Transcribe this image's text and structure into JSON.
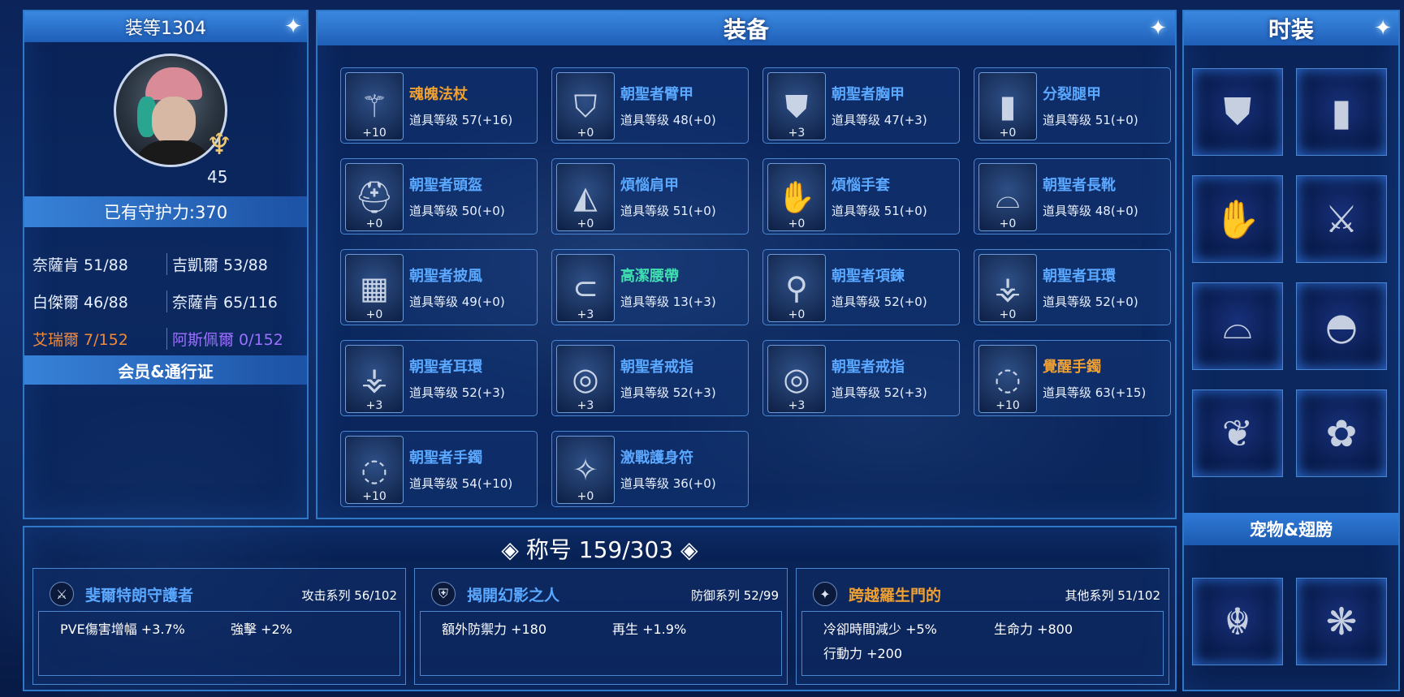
{
  "left": {
    "gear_score": "装等1304",
    "level": "45",
    "guard_power": "已有守护力:370",
    "stats": [
      [
        "奈薩肯 51/88",
        "吉凱爾 53/88"
      ],
      [
        "白傑爾 46/88",
        "奈薩肯 65/116"
      ],
      [
        "艾瑞爾 7/152",
        "阿斯佩爾 0/152"
      ]
    ],
    "membership": "会员&通行证"
  },
  "equipment": {
    "title": "装备",
    "items": [
      {
        "name": "魂魄法杖",
        "level": "道具等级 57(+16)",
        "plus": "+10",
        "color": "orange",
        "icon": "staff-icon"
      },
      {
        "name": "朝聖者臂甲",
        "level": "道具等级 48(+0)",
        "plus": "+0",
        "color": "blue",
        "icon": "shoulder-armor-icon"
      },
      {
        "name": "朝聖者胸甲",
        "level": "道具等级 47(+3)",
        "plus": "+3",
        "color": "blue",
        "icon": "chest-armor-icon"
      },
      {
        "name": "分裂腿甲",
        "level": "道具等级 51(+0)",
        "plus": "+0",
        "color": "blue",
        "icon": "leg-armor-icon"
      },
      {
        "name": "朝聖者頭盔",
        "level": "道具等级 50(+0)",
        "plus": "+0",
        "color": "blue",
        "icon": "helmet-icon"
      },
      {
        "name": "煩惱肩甲",
        "level": "道具等级 51(+0)",
        "plus": "+0",
        "color": "blue",
        "icon": "pauldron-icon"
      },
      {
        "name": "煩惱手套",
        "level": "道具等级 51(+0)",
        "plus": "+0",
        "color": "blue",
        "icon": "glove-icon"
      },
      {
        "name": "朝聖者長靴",
        "level": "道具等级 48(+0)",
        "plus": "+0",
        "color": "blue",
        "icon": "boots-icon"
      },
      {
        "name": "朝聖者披風",
        "level": "道具等级 49(+0)",
        "plus": "+0",
        "color": "blue",
        "icon": "cape-icon"
      },
      {
        "name": "高潔腰帶",
        "level": "道具等级 13(+3)",
        "plus": "+3",
        "color": "green",
        "icon": "belt-icon"
      },
      {
        "name": "朝聖者項鍊",
        "level": "道具等级 52(+0)",
        "plus": "+0",
        "color": "blue",
        "icon": "necklace-icon"
      },
      {
        "name": "朝聖者耳環",
        "level": "道具等级 52(+0)",
        "plus": "+0",
        "color": "blue",
        "icon": "earring-icon"
      },
      {
        "name": "朝聖者耳環",
        "level": "道具等级 52(+3)",
        "plus": "+3",
        "color": "blue",
        "icon": "earring-icon"
      },
      {
        "name": "朝聖者戒指",
        "level": "道具等级 52(+3)",
        "plus": "+3",
        "color": "blue",
        "icon": "ring-icon"
      },
      {
        "name": "朝聖者戒指",
        "level": "道具等级 52(+3)",
        "plus": "+3",
        "color": "blue",
        "icon": "ring-icon"
      },
      {
        "name": "覺醒手鐲",
        "level": "道具等级 63(+15)",
        "plus": "+10",
        "color": "orange",
        "icon": "bracelet-icon"
      },
      {
        "name": "朝聖者手鐲",
        "level": "道具等级 54(+10)",
        "plus": "+10",
        "color": "blue",
        "icon": "bracelet-icon"
      },
      {
        "name": "激戰護身符",
        "level": "道具等级 36(+0)",
        "plus": "+0",
        "color": "blue",
        "icon": "amulet-icon"
      }
    ]
  },
  "costume": {
    "title": "时装",
    "items": [
      "vest-icon",
      "pants-icon",
      "glove-icon",
      "weapon-icon",
      "boots-icon",
      "cap-icon",
      "wing-icon",
      "octopus-pet-icon"
    ],
    "pet_wing_title": "宠物&翅膀",
    "pet_wing_items": [
      "dragon-icon",
      "beast-icon"
    ]
  },
  "titles": {
    "header": "称号 159/303",
    "cards": [
      {
        "name": "斐爾特朗守護者",
        "series": "攻击系列 56/102",
        "color": "blue",
        "effects": [
          "PVE傷害增幅 +3.7%",
          "強擊 +2%"
        ]
      },
      {
        "name": "揭開幻影之人",
        "series": "防御系列 52/99",
        "color": "blue",
        "effects": [
          "額外防禦力 +180",
          "再生 +1.9%"
        ]
      },
      {
        "name": "跨越羅生門的",
        "series": "其他系列 51/102",
        "color": "orange",
        "effects": [
          "冷卻時間減少 +5%",
          "生命力 +800",
          "行動力 +200"
        ]
      }
    ]
  },
  "colors": {
    "orange": "#f0a030",
    "blue": "#5aa8ff",
    "green": "#3fe0b0",
    "accent": "#2f78c8"
  }
}
